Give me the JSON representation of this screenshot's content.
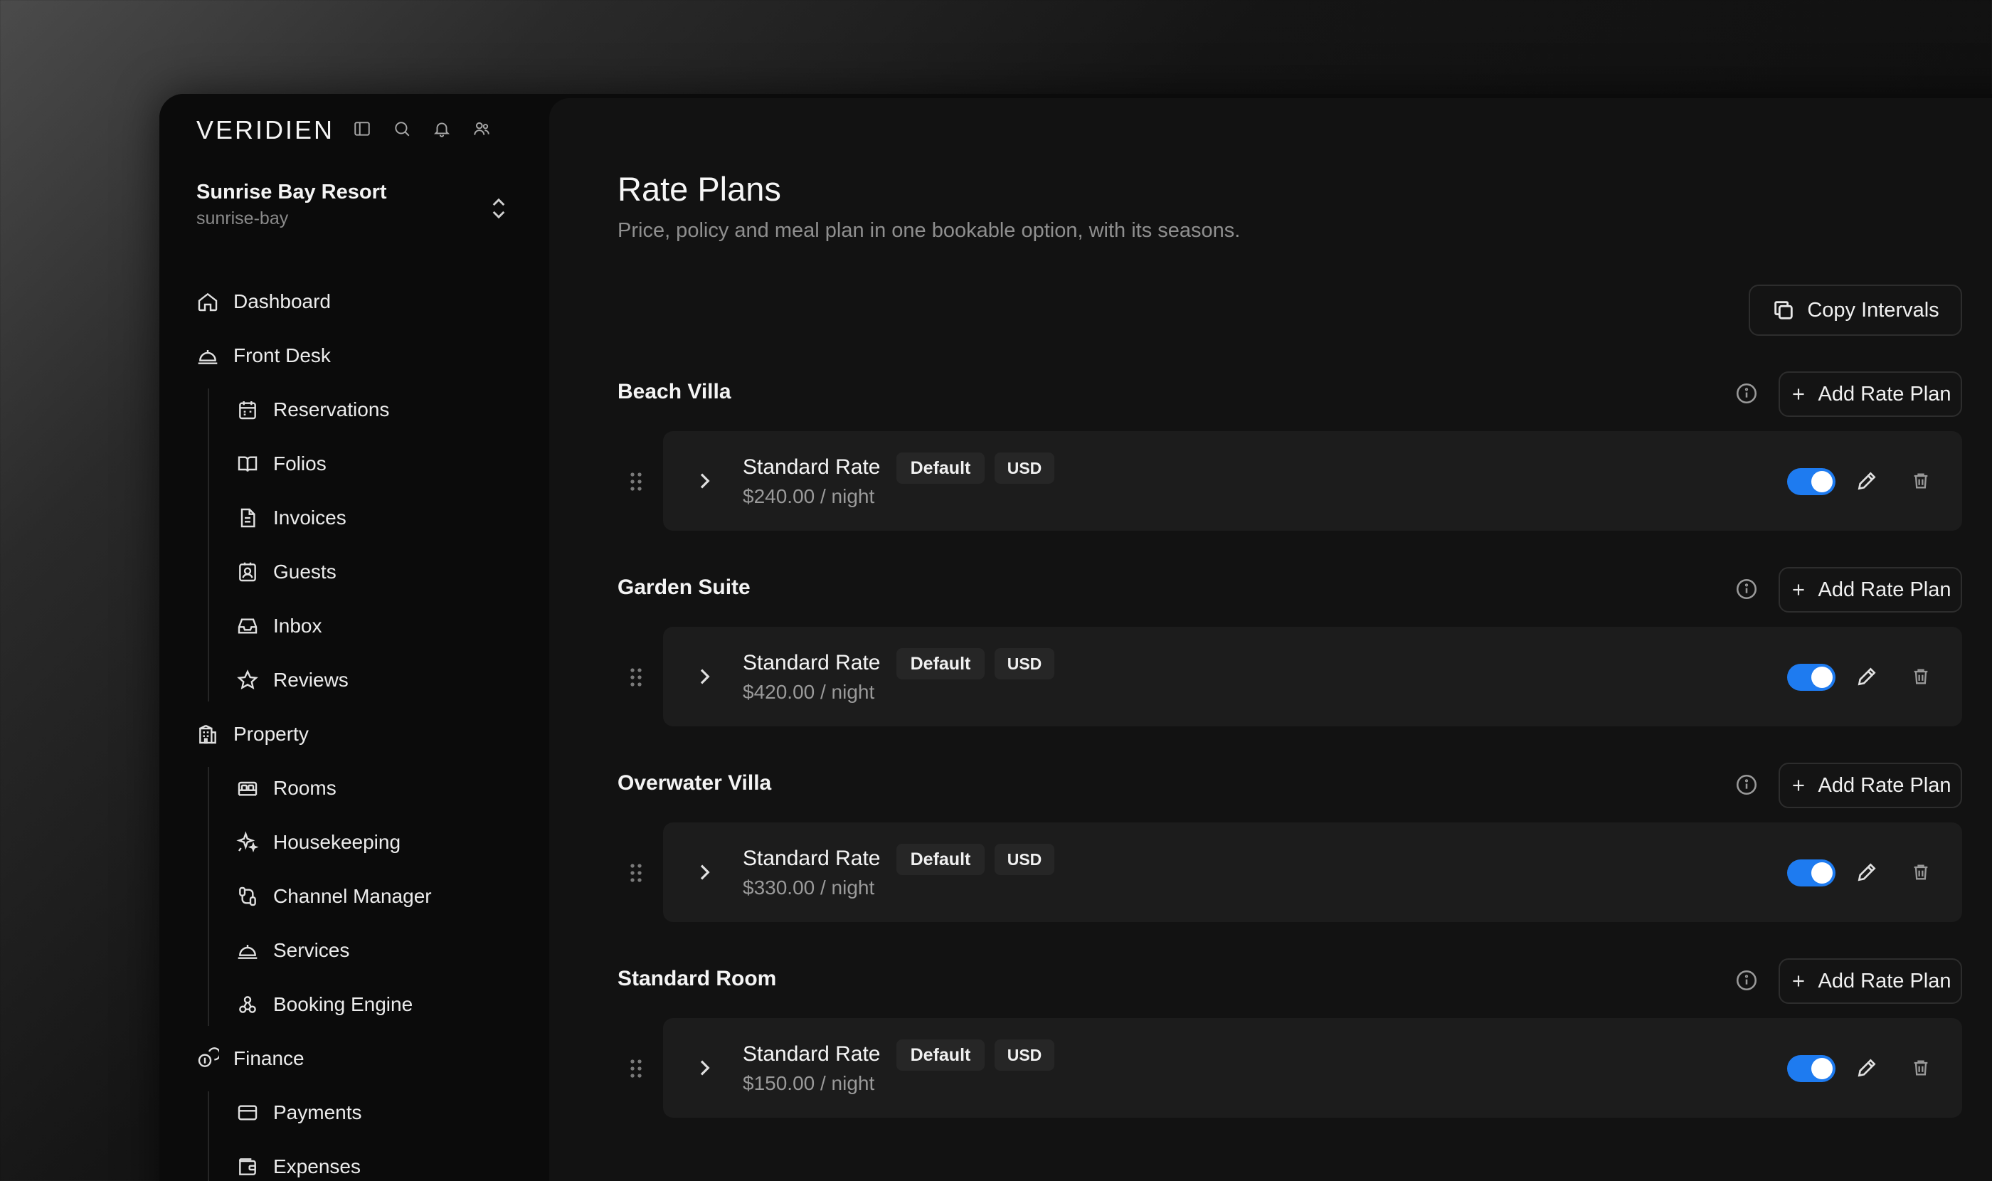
{
  "app": {
    "logo": "VERIDIEN"
  },
  "property": {
    "name": "Sunrise Bay Resort",
    "slug": "sunrise-bay"
  },
  "nav": {
    "dashboard": "Dashboard",
    "front_desk": {
      "label": "Front Desk",
      "items": [
        "Reservations",
        "Folios",
        "Invoices",
        "Guests",
        "Inbox",
        "Reviews"
      ]
    },
    "property": {
      "label": "Property",
      "items": [
        "Rooms",
        "Housekeeping",
        "Channel Manager",
        "Services",
        "Booking Engine"
      ]
    },
    "finance": {
      "label": "Finance",
      "items": [
        "Payments",
        "Expenses"
      ]
    }
  },
  "page": {
    "title": "Rate Plans",
    "subtitle": "Price, policy and meal plan in one bookable option, with its seasons.",
    "copy_button": "Copy Intervals",
    "add_button": "Add Rate Plan"
  },
  "sections": [
    {
      "title": "Beach Villa",
      "plan": {
        "name": "Standard Rate",
        "badge": "Default",
        "currency": "USD",
        "price": "$240.00 / night",
        "enabled": true
      }
    },
    {
      "title": "Garden Suite",
      "plan": {
        "name": "Standard Rate",
        "badge": "Default",
        "currency": "USD",
        "price": "$420.00 / night",
        "enabled": true
      }
    },
    {
      "title": "Overwater Villa",
      "plan": {
        "name": "Standard Rate",
        "badge": "Default",
        "currency": "USD",
        "price": "$330.00 / night",
        "enabled": true
      }
    },
    {
      "title": "Standard Room",
      "plan": {
        "name": "Standard Rate",
        "badge": "Default",
        "currency": "USD",
        "price": "$150.00 / night",
        "enabled": true
      }
    }
  ],
  "colors": {
    "accent": "#1e7bf0",
    "background": "#121212",
    "sidebar": "#0b0b0b",
    "card": "#1c1c1c"
  }
}
